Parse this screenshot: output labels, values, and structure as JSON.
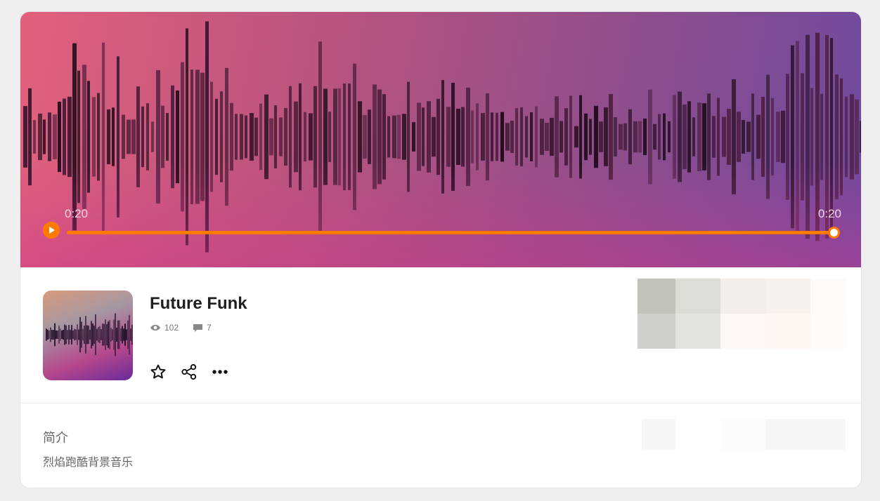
{
  "player": {
    "current_time": "0:20",
    "duration": "0:20",
    "progress": 1.0,
    "accent_color": "#ff7a00"
  },
  "track": {
    "title": "Future Funk",
    "views": "102",
    "comments": "7"
  },
  "icons": {
    "play": "play-icon",
    "views": "eye-icon",
    "comments": "comment-icon",
    "favorite": "star-icon",
    "share": "share-icon",
    "more": "more-icon"
  },
  "intro": {
    "heading": "简介",
    "text": "烈焰跑酷背景音乐"
  }
}
